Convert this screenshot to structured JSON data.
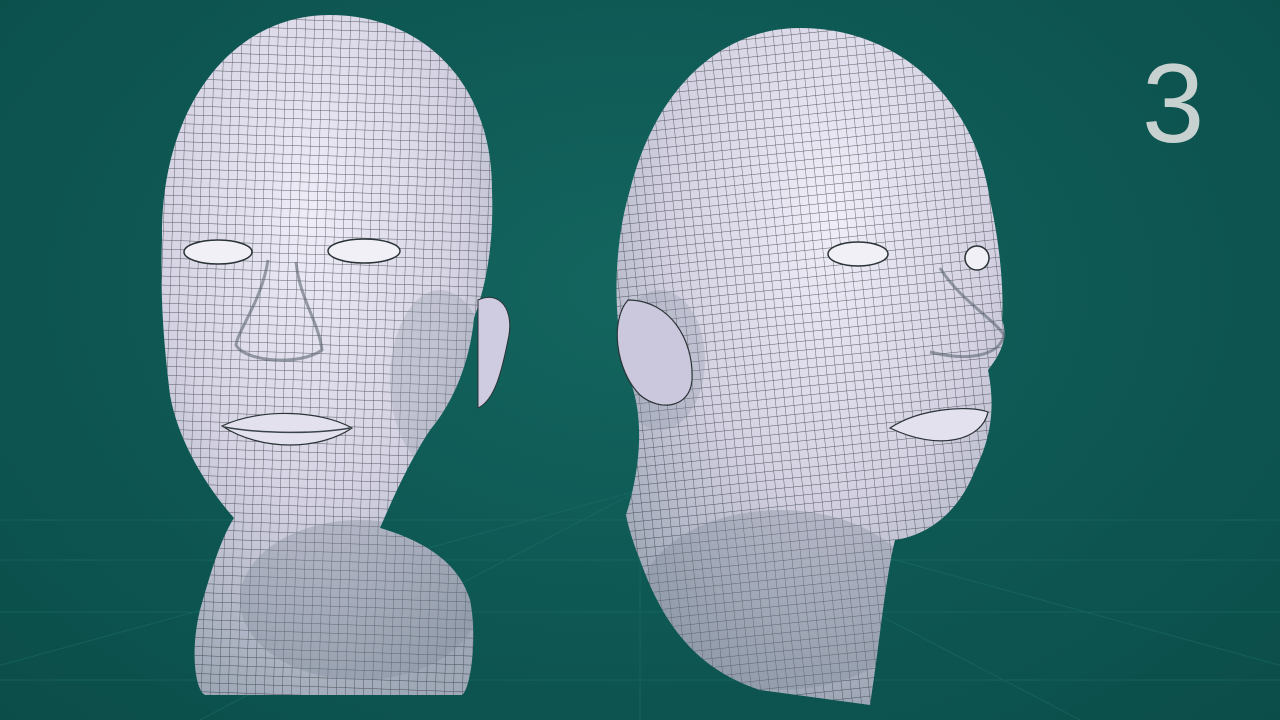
{
  "scene": {
    "background_color": "#0f5a55",
    "mesh_color": "#d8d6e6",
    "wire_color": "#2a3336",
    "slide_number": "3",
    "models": [
      {
        "name": "front-view-head",
        "icon": "wireframe-head"
      },
      {
        "name": "three-quarter-view-head",
        "icon": "wireframe-head"
      }
    ]
  }
}
